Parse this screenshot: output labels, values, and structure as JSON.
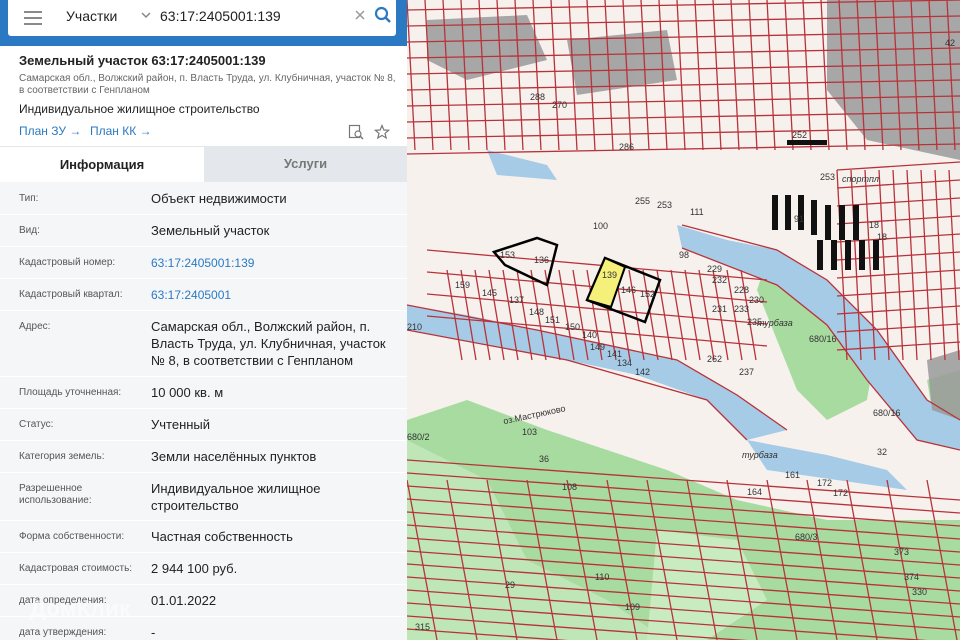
{
  "search": {
    "layer": "Участки",
    "query": "63:17:2405001:139"
  },
  "object": {
    "title": "Земельный участок 63:17:2405001:139",
    "address": "Самарская обл., Волжский район, п. Власть Труда, ул. Клубничная, участок № 8, в соответствии с Генпланом",
    "use": "Индивидуальное жилищное строительство",
    "plan_zu": "План ЗУ",
    "plan_kk": "План КК"
  },
  "tabs": {
    "info": "Информация",
    "services": "Услуги"
  },
  "info": [
    {
      "label": "Тип:",
      "value": "Объект недвижимости"
    },
    {
      "label": "Вид:",
      "value": "Земельный участок"
    },
    {
      "label": "Кадастровый номер:",
      "value": "63:17:2405001:139"
    },
    {
      "label": "Кадастровый квартал:",
      "value": "63:17:2405001"
    },
    {
      "label": "Адрес:",
      "value": "Самарская обл., Волжский район, п. Власть Труда, ул. Клубничная, участок № 8, в соответствии с Генпланом"
    },
    {
      "label": "Площадь уточненная:",
      "value": "10 000 кв. м"
    },
    {
      "label": "Статус:",
      "value": "Учтенный"
    },
    {
      "label": "Категория земель:",
      "value": "Земли населённых пунктов"
    },
    {
      "label": "Разрешенное использование:",
      "value": "Индивидуальное жилищное строительство"
    },
    {
      "label": "Форма собственности:",
      "value": "Частная собственность"
    },
    {
      "label": "Кадастровая стоимость:",
      "value": "2 944 100 руб."
    },
    {
      "label": "дата определения:",
      "value": "01.01.2022"
    },
    {
      "label": "дата утверждения:",
      "value": "-"
    }
  ],
  "watermark": "ДомКлик",
  "map": {
    "labels": [
      "288",
      "270",
      "252",
      "253",
      "286",
      "255",
      "253",
      "111",
      "100",
      "91",
      "18",
      "18",
      "153",
      "136",
      "98",
      "139",
      "146",
      "152",
      "229",
      "228",
      "230",
      "233",
      "235",
      "231",
      "237",
      "262",
      "159",
      "145",
      "137",
      "148",
      "151",
      "150",
      "140",
      "149",
      "141",
      "134",
      "142",
      "210",
      "103",
      "108",
      "110",
      "109",
      "36",
      "32",
      "161",
      "164",
      "172",
      "172",
      "373",
      "374",
      "330",
      "315",
      "29",
      "680/16",
      "680/16",
      "680/3",
      "680/2",
      "42",
      "232"
    ],
    "lake_label": "оз.Мастрюково",
    "place_labels": [
      "спортпл",
      "турбаза",
      "турбаза"
    ],
    "colors": {
      "parcel_line": "#b8323a",
      "water": "#a6cbe6",
      "forest": "#a8dba0",
      "built": "#9a9a9a",
      "selected": "#f5f07a"
    }
  },
  "colors": {
    "accent": "#2b79c2",
    "panel_bg": "#f4f6f8"
  }
}
